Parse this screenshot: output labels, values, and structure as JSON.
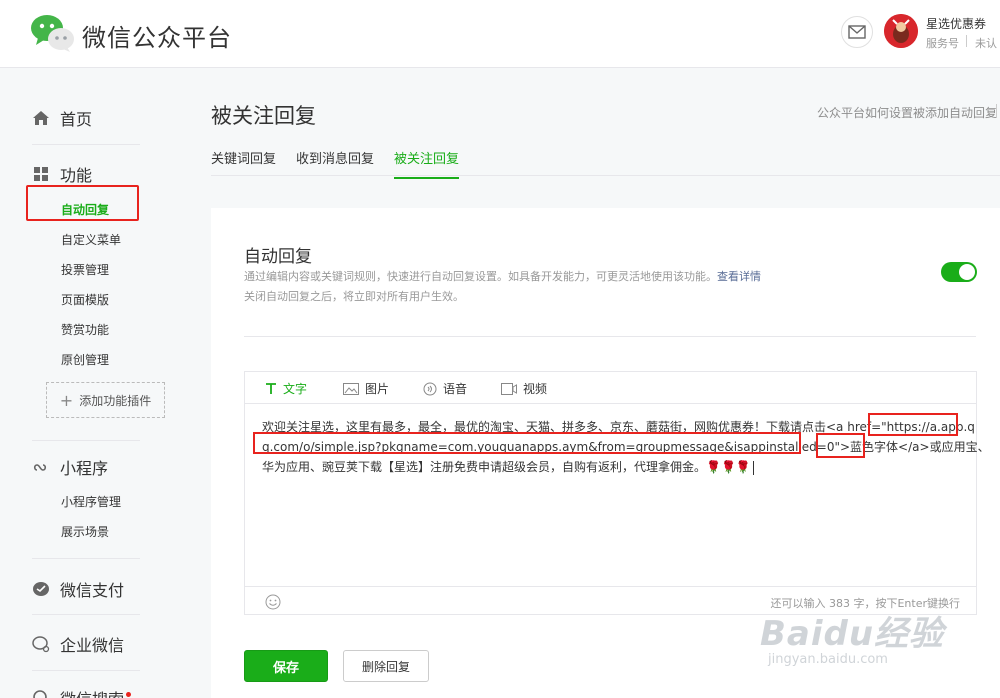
{
  "header": {
    "brand": "微信公众平台",
    "account_name": "星选优惠券",
    "account_type": "服务号",
    "account_verify": "未认"
  },
  "sidebar": {
    "home": "首页",
    "features": "功能",
    "feature_items": [
      "自动回复",
      "自定义菜单",
      "投票管理",
      "页面模版",
      "赞赏功能",
      "原创管理"
    ],
    "add_plugin": "添加功能插件",
    "mini_program": "小程序",
    "mini_items": [
      "小程序管理",
      "展示场景"
    ],
    "pay": "微信支付",
    "work": "企业微信",
    "search": "微信搜索"
  },
  "main": {
    "title": "被关注回复",
    "help_link": "公众平台如何设置被添加自动回复",
    "tabs": [
      "关键词回复",
      "收到消息回复",
      "被关注回复"
    ],
    "active_tab": "被关注回复"
  },
  "card": {
    "title": "自动回复",
    "desc1": "通过编辑内容或关键词规则，快速进行自动回复设置。如具备开发能力，可更灵活地使用该功能。",
    "desc1_link": "查看详情",
    "desc2": "关闭自动回复之后，将立即对所有用户生效。",
    "toggle_on": true
  },
  "editor": {
    "tabs": [
      "文字",
      "图片",
      "语音",
      "视频"
    ],
    "active_tab": "文字",
    "content_lines": [
      "欢迎关注星选，这里有最多，最全，最优的淘宝、天猫、拼多多、京东、蘑菇街，网购优惠券！下载请点击<a href=\"https://a.app.q",
      "q.com/o/simple.jsp?pkgname=com.youquanapps.aym&from=groupmessage&isappinstalled=0\">蓝色字体</a>或应用宝、",
      "华为应用、豌豆荚下载【星选】注册免费申请超级会员，自购有返利，代理拿佣金。🌹🌹🌹"
    ],
    "char_count": "还可以输入 383 字，按下Enter键换行"
  },
  "buttons": {
    "save": "保存",
    "delete": "删除回复"
  },
  "watermark": {
    "big": "Baidu经验",
    "small": "jingyan.baidu.com"
  },
  "colors": {
    "accent_green": "#1aad19",
    "highlight_red": "#e8231e",
    "link_blue": "#576b95"
  }
}
